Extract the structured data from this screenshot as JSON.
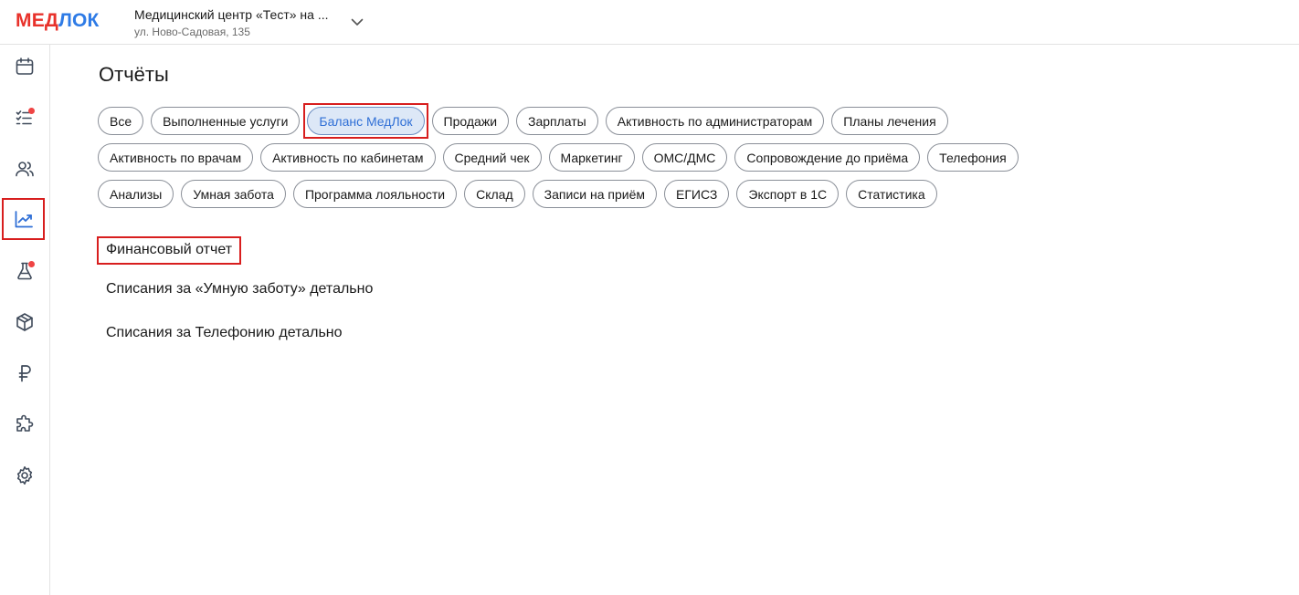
{
  "header": {
    "logo_part1": "МЕД",
    "logo_part2": "ЛОК",
    "clinic_name": "Медицинский центр «Тест» на ...",
    "clinic_address": "ул. Ново-Садовая, 135"
  },
  "sidebar": {
    "items": [
      {
        "icon": "calendar-icon",
        "badge": false,
        "active": false
      },
      {
        "icon": "tasks-icon",
        "badge": true,
        "active": false
      },
      {
        "icon": "users-icon",
        "badge": false,
        "active": false
      },
      {
        "icon": "chart-icon",
        "badge": false,
        "active": true
      },
      {
        "icon": "flask-icon",
        "badge": true,
        "active": false
      },
      {
        "icon": "box-icon",
        "badge": false,
        "active": false
      },
      {
        "icon": "ruble-icon",
        "badge": false,
        "active": false
      },
      {
        "icon": "puzzle-icon",
        "badge": false,
        "active": false
      },
      {
        "icon": "gear-icon",
        "badge": false,
        "active": false
      }
    ],
    "badge_color": "#ef4444"
  },
  "main": {
    "title": "Отчёты",
    "chip_rows": [
      [
        "Все",
        "Выполненные услуги",
        "Баланс МедЛок",
        "Продажи",
        "Зарплаты",
        "Активность по администраторам",
        "Планы лечения"
      ],
      [
        "Активность по врачам",
        "Активность по кабинетам",
        "Средний чек",
        "Маркетинг",
        "ОМС/ДМС",
        "Сопровождение до приёма",
        "Телефония"
      ],
      [
        "Анализы",
        "Умная забота",
        "Программа лояльности",
        "Склад",
        "Записи на приём",
        "ЕГИСЗ",
        "Экспорт в 1С",
        "Статистика"
      ]
    ],
    "selected_chip": "Баланс МедЛок",
    "reports": [
      "Финансовый отчет",
      "Списания за «Умную заботу» детально",
      "Списания за Телефонию детально"
    ]
  },
  "colors": {
    "accent_blue": "#2f6fd6",
    "brand_red": "#e8322b",
    "brand_blue": "#2e7be6",
    "highlight_red": "#d81e1e"
  }
}
